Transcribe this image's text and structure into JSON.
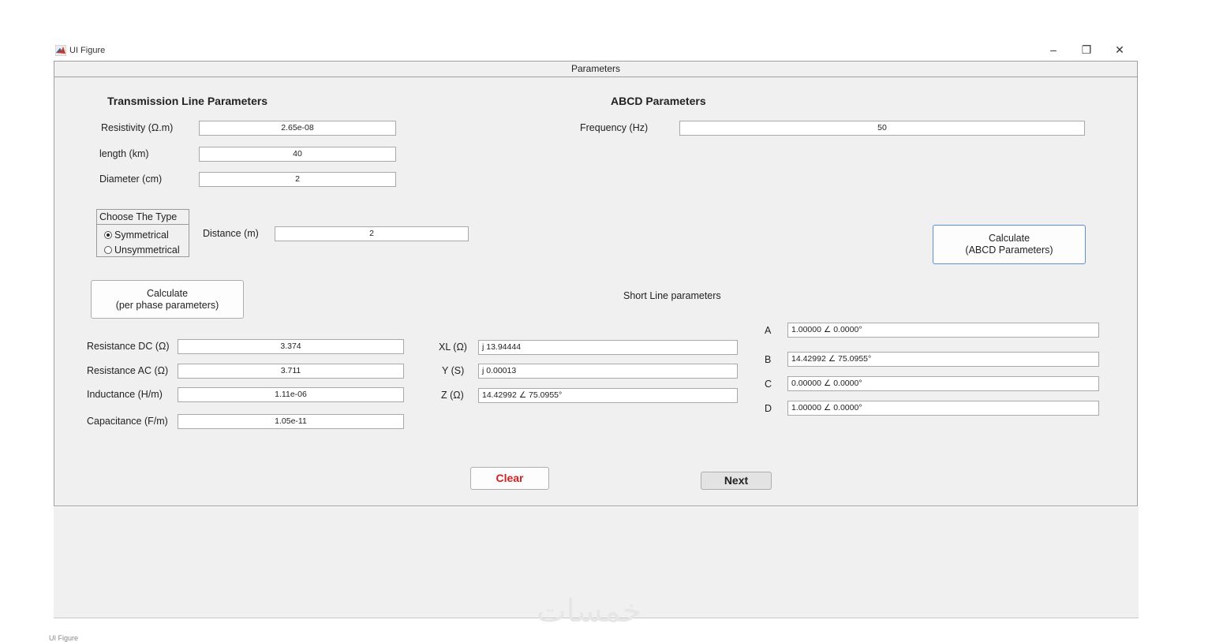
{
  "window": {
    "title": "UI Figure",
    "controls": {
      "minimize": "–",
      "restore": "❐",
      "close": "✕"
    }
  },
  "panel": {
    "title": "Parameters"
  },
  "tl_section": {
    "title": "Transmission Line Parameters",
    "resistivity": {
      "label": "Resistivity (Ω.m)",
      "value": "2.65e-08"
    },
    "length": {
      "label": "length (km)",
      "value": "40"
    },
    "diameter": {
      "label": "Diameter (cm)",
      "value": "2"
    },
    "type_group": {
      "title": "Choose The Type",
      "options": [
        {
          "label": "Symmetrical",
          "selected": true
        },
        {
          "label": "Unsymmetrical",
          "selected": false
        }
      ]
    },
    "distance": {
      "label": "Distance (m)",
      "value": "2"
    },
    "calc_button": {
      "line1": "Calculate",
      "line2": "(per phase parameters)"
    }
  },
  "per_phase": {
    "resistance_dc": {
      "label": "Resistance DC (Ω)",
      "value": "3.374"
    },
    "resistance_ac": {
      "label": "Resistance AC (Ω)",
      "value": "3.711"
    },
    "inductance": {
      "label": "Inductance (H/m)",
      "value": "1.11e-06"
    },
    "capacitance": {
      "label": "Capacitance (F/m)",
      "value": "1.05e-11"
    }
  },
  "abcd_section": {
    "title": "ABCD Parameters",
    "frequency": {
      "label": "Frequency (Hz)",
      "value": "50"
    },
    "calc_button": {
      "line1": "Calculate",
      "line2": "(ABCD Parameters)"
    },
    "short_line_label": "Short Line parameters"
  },
  "impedance": {
    "xl": {
      "label": "XL (Ω)",
      "value": "j 13.94444"
    },
    "y": {
      "label": "Y (S)",
      "value": "j 0.00013"
    },
    "z": {
      "label": "Z (Ω)",
      "value": "14.42992 ∠ 75.0955°"
    }
  },
  "abcd": {
    "a": {
      "label": "A",
      "value": "1.00000 ∠ 0.0000°"
    },
    "b": {
      "label": "B",
      "value": "14.42992 ∠ 75.0955°"
    },
    "c": {
      "label": "C",
      "value": "0.00000 ∠ 0.0000°"
    },
    "d": {
      "label": "D",
      "value": "1.00000 ∠ 0.0000°"
    }
  },
  "actions": {
    "clear": "Clear",
    "next": "Next"
  },
  "watermark": "خمسات",
  "bottom_window_title": "UI Figure",
  "colors": {
    "panel_bg": "#f0f0f0",
    "clear_text": "#d21f1f",
    "accent_border": "#5a8fd0"
  }
}
